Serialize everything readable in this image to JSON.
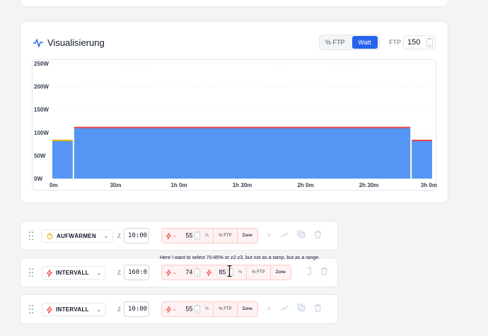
{
  "visualization": {
    "title": "Visualisierung",
    "toggle_pct": "% FTP",
    "toggle_watt": "Watt",
    "ftp_label": "FTP",
    "ftp_value": "150",
    "active_mode": "Watt"
  },
  "chart_data": {
    "type": "area",
    "title": "",
    "xlabel": "",
    "ylabel": "",
    "ylim": [
      0,
      250
    ],
    "y_ticks": [
      "0W",
      "50W",
      "100W",
      "150W",
      "200W",
      "250W"
    ],
    "x_ticks": [
      "0m",
      "30m",
      "1h 0m",
      "1h 30m",
      "2h 0m",
      "2h 30m",
      "3h 0m"
    ],
    "xlim_minutes": [
      0,
      180
    ],
    "grid": true,
    "segments": [
      {
        "name": "Aufwärmen",
        "start_min": 0,
        "end_min": 10,
        "watts": 83,
        "color": "#eab308"
      },
      {
        "name": "Intervall",
        "start_min": 10,
        "end_min": 170,
        "watts": 111,
        "color": "#ef4444"
      },
      {
        "name": "Intervall",
        "start_min": 170,
        "end_min": 180,
        "watts": 83,
        "color": "#ef4444"
      }
    ],
    "fill_color": "#5596f5"
  },
  "blocks": [
    {
      "type_label": "AUFWÄRMEN",
      "icon": "timer-icon",
      "z": "Z",
      "duration": "10:00",
      "power": "55",
      "power_max": "",
      "unit": "%",
      "unit_chip": "% FTP",
      "zone_chip": "Zone"
    },
    {
      "type_label": "INTERVALL",
      "icon": "lightning-icon",
      "z": "Z",
      "duration": "160:0",
      "power": "74",
      "power_max": "85",
      "unit": "%",
      "unit_chip": "% FTP",
      "zone_chip": "Zone"
    },
    {
      "type_label": "INTERVALL",
      "icon": "lightning-icon",
      "z": "Z",
      "duration": "10:00",
      "power": "55",
      "power_max": "",
      "unit": "%",
      "unit_chip": "% FTP",
      "zone_chip": "Zone"
    }
  ],
  "note": "Here I want to select 70-85% or z2-z3, but not as a ramp, but as a range."
}
